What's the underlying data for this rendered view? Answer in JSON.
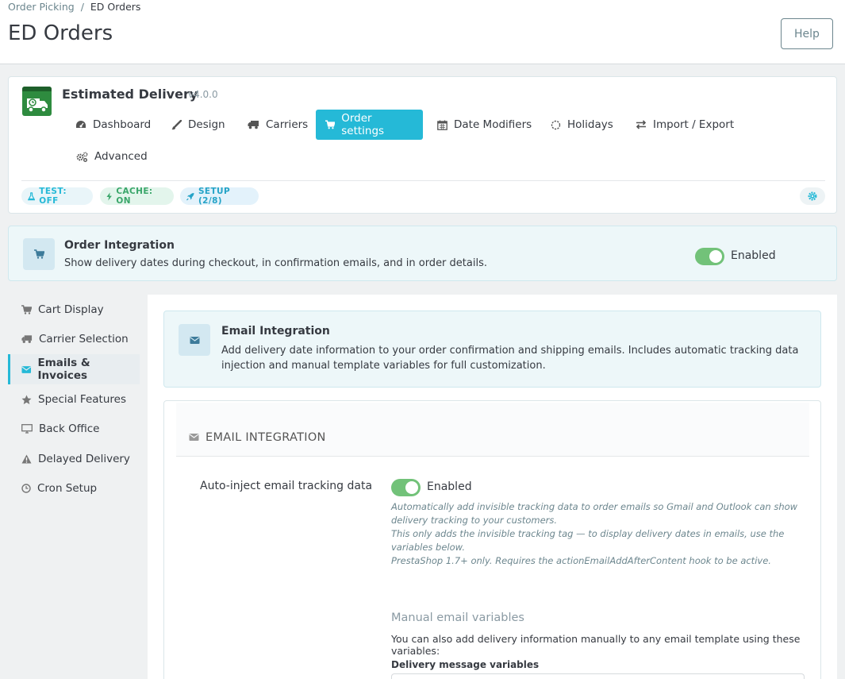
{
  "breadcrumb": {
    "parent": "Order Picking",
    "separator": "/",
    "current": "ED Orders"
  },
  "page": {
    "title": "ED Orders",
    "help_label": "Help"
  },
  "module": {
    "title": "Estimated Delivery",
    "version": "v4.0.0",
    "tabs": [
      {
        "label": "Dashboard",
        "icon": "dashboard-icon"
      },
      {
        "label": "Design",
        "icon": "brush-icon"
      },
      {
        "label": "Carriers",
        "icon": "truck-icon"
      },
      {
        "label": "Order settings",
        "icon": "cart-icon",
        "active": true
      },
      {
        "label": "Date Modifiers",
        "icon": "calendar-icon"
      },
      {
        "label": "Holidays",
        "icon": "spinner-icon"
      },
      {
        "label": "Import / Export",
        "icon": "exchange-icon"
      },
      {
        "label": "Advanced",
        "icon": "cogs-icon"
      }
    ],
    "badges": {
      "test": "TEST: OFF",
      "cache": "CACHE: ON",
      "setup": "SETUP (2/8)"
    }
  },
  "order_integration": {
    "title": "Order Integration",
    "description": "Show delivery dates during checkout, in confirmation emails, and in order details.",
    "status_label": "Enabled",
    "enabled": true
  },
  "sidebar": {
    "items": [
      {
        "label": "Cart Display",
        "icon": "cart-icon"
      },
      {
        "label": "Carrier Selection",
        "icon": "truck-icon"
      },
      {
        "label": "Emails & Invoices",
        "icon": "envelope-icon",
        "active": true
      },
      {
        "label": "Special Features",
        "icon": "star-icon"
      },
      {
        "label": "Back Office",
        "icon": "desktop-icon"
      },
      {
        "label": "Delayed Delivery",
        "icon": "warning-icon"
      },
      {
        "label": "Cron Setup",
        "icon": "clock-icon"
      }
    ]
  },
  "email_integration": {
    "title": "Email Integration",
    "description": "Add delivery date information to your order confirmation and shipping emails. Includes automatic tracking data injection and manual template variables for full customization."
  },
  "form": {
    "heading": "EMAIL INTEGRATION",
    "auto_inject": {
      "label": "Auto-inject email tracking data",
      "status_label": "Enabled",
      "enabled": true,
      "help": [
        "Automatically add invisible tracking data to order emails so Gmail and Outlook can show delivery tracking to your customers.",
        "This only adds the invisible tracking tag — to display delivery dates in emails, use the variables below.",
        "PrestaShop 1.7+ only. Requires the actionEmailAddAfterContent hook to be active."
      ]
    },
    "manual": {
      "title": "Manual email variables",
      "description": "You can also add delivery information manually to any email template using these variables:",
      "variables_label": "Delivery message variables"
    }
  },
  "colors": {
    "accent": "#25b9d7",
    "switch_on": "#72c279",
    "cache_green": "#3aa66a"
  }
}
